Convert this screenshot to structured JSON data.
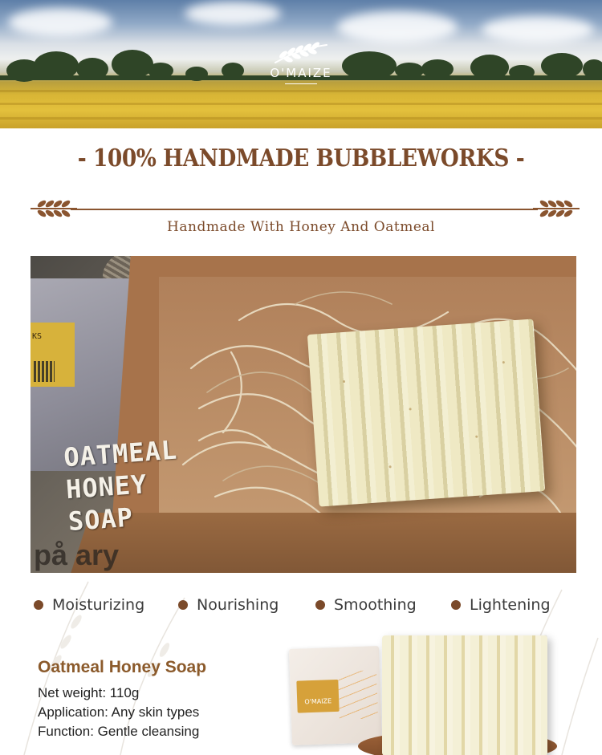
{
  "brand": {
    "name": "O'MAIZE",
    "accent_color": "#7b4a2a",
    "icon": "wheat-logo-icon"
  },
  "header": {
    "headline": "- 100% HANDMADE BUBBLEWORKS -",
    "subtitle": "Handmade With Honey And Oatmeal"
  },
  "photo": {
    "caption_lines": [
      "OATMEAL",
      "HONEY",
      "SOAP"
    ],
    "box_label": "KS",
    "newspaper_text": "på ary"
  },
  "benefits": [
    {
      "label": "Moisturizing"
    },
    {
      "label": "Nourishing"
    },
    {
      "label": "Smoothing"
    },
    {
      "label": "Lightening"
    }
  ],
  "product": {
    "title": "Oatmeal Honey Soap",
    "lines": [
      "Net weight: 110g",
      "Application: Any skin types",
      "Function: Gentle cleansing"
    ],
    "package_label": "O'MAIZE"
  }
}
